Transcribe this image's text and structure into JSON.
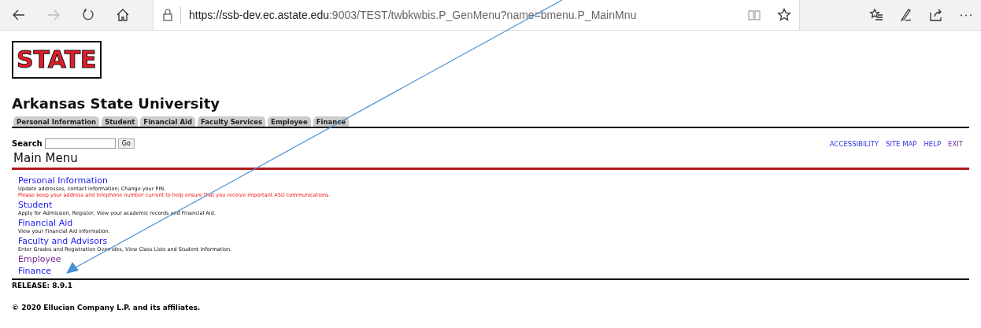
{
  "browser": {
    "url_host": "https://ssb-dev.ec.astate.edu",
    "url_path": ":9003/TEST/twbkwbis.P_GenMenu?name=bmenu.P_MainMnu"
  },
  "logo": {
    "text": "STATE"
  },
  "title": "Arkansas State University",
  "tabs": [
    {
      "label": "Personal Information",
      "selected": false
    },
    {
      "label": "Student",
      "selected": false
    },
    {
      "label": "Financial Aid",
      "selected": false
    },
    {
      "label": "Faculty Services",
      "selected": false
    },
    {
      "label": "Employee",
      "selected": false
    },
    {
      "label": "Finance",
      "selected": false
    }
  ],
  "search": {
    "label": "Search",
    "button": "Go"
  },
  "links": [
    {
      "label": "ACCESSIBILITY",
      "visited": false
    },
    {
      "label": "SITE MAP",
      "visited": false
    },
    {
      "label": "HELP",
      "visited": false
    },
    {
      "label": "EXIT",
      "visited": true
    }
  ],
  "heading": "Main Menu",
  "menu": [
    {
      "label": "Personal Information",
      "visited": false,
      "description": "Update addresses, contact information; Change your PIN.",
      "notice": "Please keep your address and telephone number current to help ensure that you receive important ASU communications."
    },
    {
      "label": "Student",
      "visited": false,
      "description": "Apply for Admission, Register, View your academic records and Financial Aid."
    },
    {
      "label": "Financial Aid",
      "visited": false,
      "description": "View your Financial Aid information."
    },
    {
      "label": "Faculty and Advisors",
      "visited": false,
      "description": "Enter Grades and Registration Overrides, View Class Lists and Student Information."
    },
    {
      "label": "Employee",
      "visited": true
    },
    {
      "label": "Finance",
      "visited": false
    }
  ],
  "release": "RELEASE: 8.9.1",
  "copyright": "© 2020 Ellucian Company L.P. and its affiliates."
}
